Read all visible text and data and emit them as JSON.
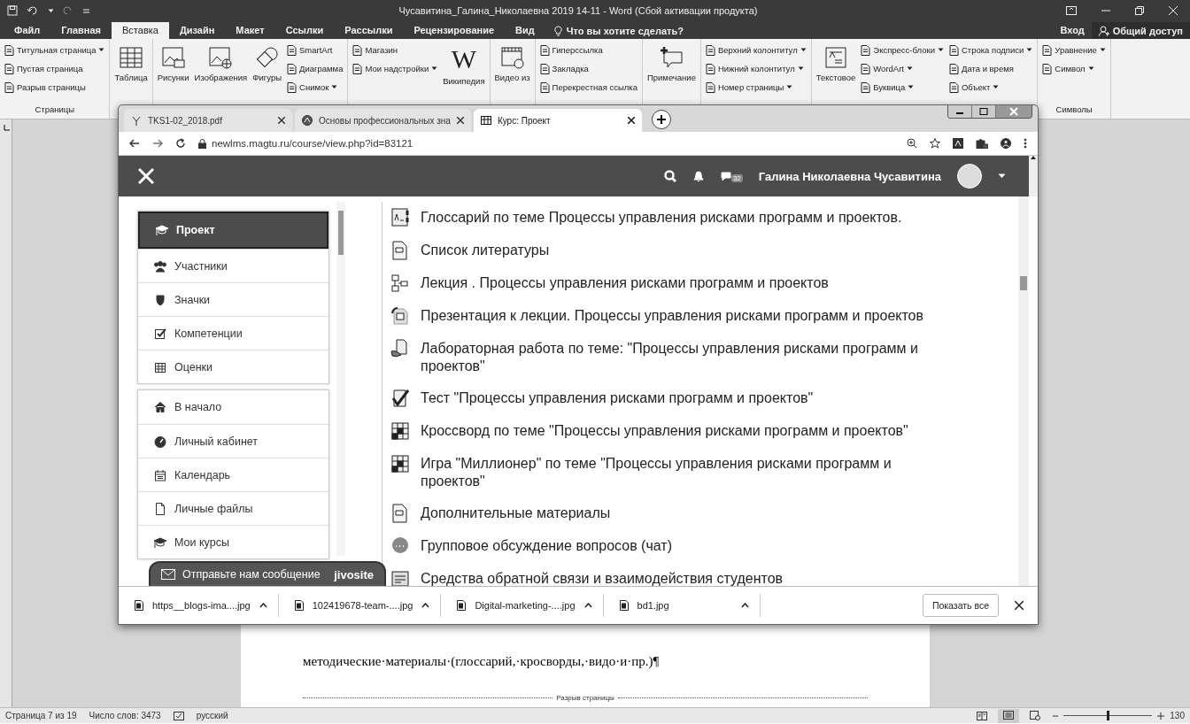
{
  "word": {
    "title": "Чусавитина_Галина_Николаевна 2019 14-11 - Word (Сбой активации продукта)",
    "tabs": [
      {
        "label": "Файл",
        "selected": false
      },
      {
        "label": "Главная",
        "selected": false
      },
      {
        "label": "Вставка",
        "selected": true
      },
      {
        "label": "Дизайн",
        "selected": false
      },
      {
        "label": "Макет",
        "selected": false
      },
      {
        "label": "Ссылки",
        "selected": false
      },
      {
        "label": "Рассылки",
        "selected": false
      },
      {
        "label": "Рецензирование",
        "selected": false
      },
      {
        "label": "Вид",
        "selected": false
      }
    ],
    "tell_me": "Что вы хотите сделать?",
    "sign_in": "Вход",
    "share": "Общий доступ",
    "ribbon": [
      {
        "label": "Страницы",
        "columns": [
          [
            {
              "kind": "small",
              "label": "Титульная страница",
              "dropdown": true
            },
            {
              "kind": "small",
              "label": "Пустая страница",
              "dropdown": false
            },
            {
              "kind": "small",
              "label": "Разрыв страницы",
              "dropdown": false
            }
          ]
        ]
      },
      {
        "columns": [
          [
            {
              "kind": "large",
              "label": "Таблица",
              "dropdown": false
            }
          ]
        ]
      },
      {
        "columns": [
          [
            {
              "kind": "large",
              "label": "Рисунки",
              "dropdown": false
            }
          ],
          [
            {
              "kind": "large",
              "label": "Изображения",
              "dropdown": false
            }
          ],
          [
            {
              "kind": "large",
              "label": "Фигуры",
              "dropdown": false
            }
          ],
          [
            {
              "kind": "small",
              "label": "SmartArt",
              "dropdown": false
            },
            {
              "kind": "small",
              "label": "Диаграмма",
              "dropdown": false
            },
            {
              "kind": "small",
              "label": "Снимок",
              "dropdown": true
            }
          ]
        ]
      },
      {
        "columns": [
          [
            {
              "kind": "small",
              "label": "Магазин",
              "dropdown": false
            },
            {
              "kind": "small",
              "label": "Мои надстройки",
              "dropdown": true
            }
          ],
          [
            {
              "kind": "large",
              "label": "Википедия",
              "glyph": "W",
              "dropdown": false
            }
          ]
        ]
      },
      {
        "columns": [
          [
            {
              "kind": "large",
              "label": "Видео из",
              "dropdown": false
            }
          ]
        ]
      },
      {
        "columns": [
          [
            {
              "kind": "small",
              "label": "Гиперссылка",
              "dropdown": false
            },
            {
              "kind": "small",
              "label": "Закладка",
              "dropdown": false
            },
            {
              "kind": "small",
              "label": "Перекрестная ссылка",
              "dropdown": false
            }
          ]
        ]
      },
      {
        "columns": [
          [
            {
              "kind": "large",
              "label": "Примечание",
              "dropdown": false
            }
          ]
        ]
      },
      {
        "columns": [
          [
            {
              "kind": "small",
              "label": "Верхний колонтитул",
              "dropdown": true
            },
            {
              "kind": "small",
              "label": "Нижний колонтитул",
              "dropdown": true
            },
            {
              "kind": "small",
              "label": "Номер страницы",
              "dropdown": true
            }
          ]
        ]
      },
      {
        "columns": [
          [
            {
              "kind": "large",
              "label": "Текстовое",
              "dropdown": false
            }
          ],
          [
            {
              "kind": "small",
              "label": "Экспресс-блоки",
              "dropdown": true
            },
            {
              "kind": "small",
              "label": "WordArt",
              "dropdown": true
            },
            {
              "kind": "small",
              "label": "Буквица",
              "dropdown": true
            }
          ],
          [
            {
              "kind": "small",
              "label": "Строка подписи",
              "dropdown": true
            },
            {
              "kind": "small",
              "label": "Дата и время",
              "dropdown": false
            },
            {
              "kind": "small",
              "label": "Объект",
              "dropdown": true
            }
          ]
        ]
      },
      {
        "label": "Символы",
        "columns": [
          [
            {
              "kind": "small",
              "label": "Уравнение",
              "dropdown": true
            },
            {
              "kind": "small",
              "label": "Символ",
              "dropdown": true
            }
          ]
        ]
      }
    ],
    "document": {
      "paragraph": "методические·материалы·(глоссарий,·кросворды,·видо·и·пр.)¶",
      "page_break": "Разрыв страницы"
    },
    "status_bar": {
      "page": "Страница 7 из 19",
      "words": "Число слов: 3473",
      "language": "русский",
      "zoom_slider": {
        "level": 0.5
      },
      "zoom": "130"
    }
  },
  "browser": {
    "tabs": [
      {
        "title": "TKS1-02_2018.pdf",
        "selected": false
      },
      {
        "title": "Основы профессиональных зна",
        "selected": false
      },
      {
        "title": "Курс: Проект",
        "selected": true
      }
    ],
    "address": "newlms.magtu.ru/course/view.php?id=83121",
    "site": {
      "messages_count": "32",
      "user": "Галина Николаевна Чусавитина",
      "sidebar": [
        [
          {
            "label": "Проект",
            "selected": true
          },
          {
            "label": "Участники",
            "selected": false
          },
          {
            "label": "Значки",
            "selected": false
          },
          {
            "label": "Компетенции",
            "selected": false
          },
          {
            "label": "Оценки",
            "selected": false
          }
        ],
        [
          {
            "label": "В начало",
            "selected": false
          },
          {
            "label": "Личный кабинет",
            "selected": false
          },
          {
            "label": "Календарь",
            "selected": false
          },
          {
            "label": "Личные файлы",
            "selected": false
          },
          {
            "label": "Мои курсы",
            "selected": false
          }
        ]
      ],
      "activities": [
        {
          "kind": "glossary",
          "text": "Глоссарий по теме Процессы управления рисками программ и проектов."
        },
        {
          "kind": "page",
          "text": "Список литературы"
        },
        {
          "kind": "book",
          "text": "Лекция . Процессы управления рисками программ и проектов"
        },
        {
          "kind": "presentation",
          "text": "Презентация к лекции. Процессы управления рисками программ и проектов"
        },
        {
          "kind": "assignment",
          "text": "Лабораторная работа по теме: \"Процессы управления рисками программ и проектов\""
        },
        {
          "kind": "quiz",
          "text": "Тест \"Процессы управления рисками программ и проектов\""
        },
        {
          "kind": "crossword",
          "text": "Кроссворд по теме \"Процессы управления рисками программ и проектов\""
        },
        {
          "kind": "crossword",
          "text": "Игра \"Миллионер\" по теме \"Процессы управления рисками программ и проектов\""
        },
        {
          "kind": "page",
          "text": "Дополнительные материалы"
        },
        {
          "kind": "chat",
          "text": "Групповое обсуждение вопросов (чат)"
        },
        {
          "kind": "feedback",
          "text": "Средства обратной связи и взаимодействия студентов"
        }
      ],
      "chat": {
        "label": "Отправьте нам сообщение",
        "brand": "jivosite"
      }
    },
    "downloads": [
      {
        "name": "https__blogs-ima....jpg"
      },
      {
        "name": "102419678-team-....jpg"
      },
      {
        "name": "Digital-marketing-....jpg"
      },
      {
        "name": "bd1.jpg"
      }
    ],
    "show_all": "Показать все"
  }
}
